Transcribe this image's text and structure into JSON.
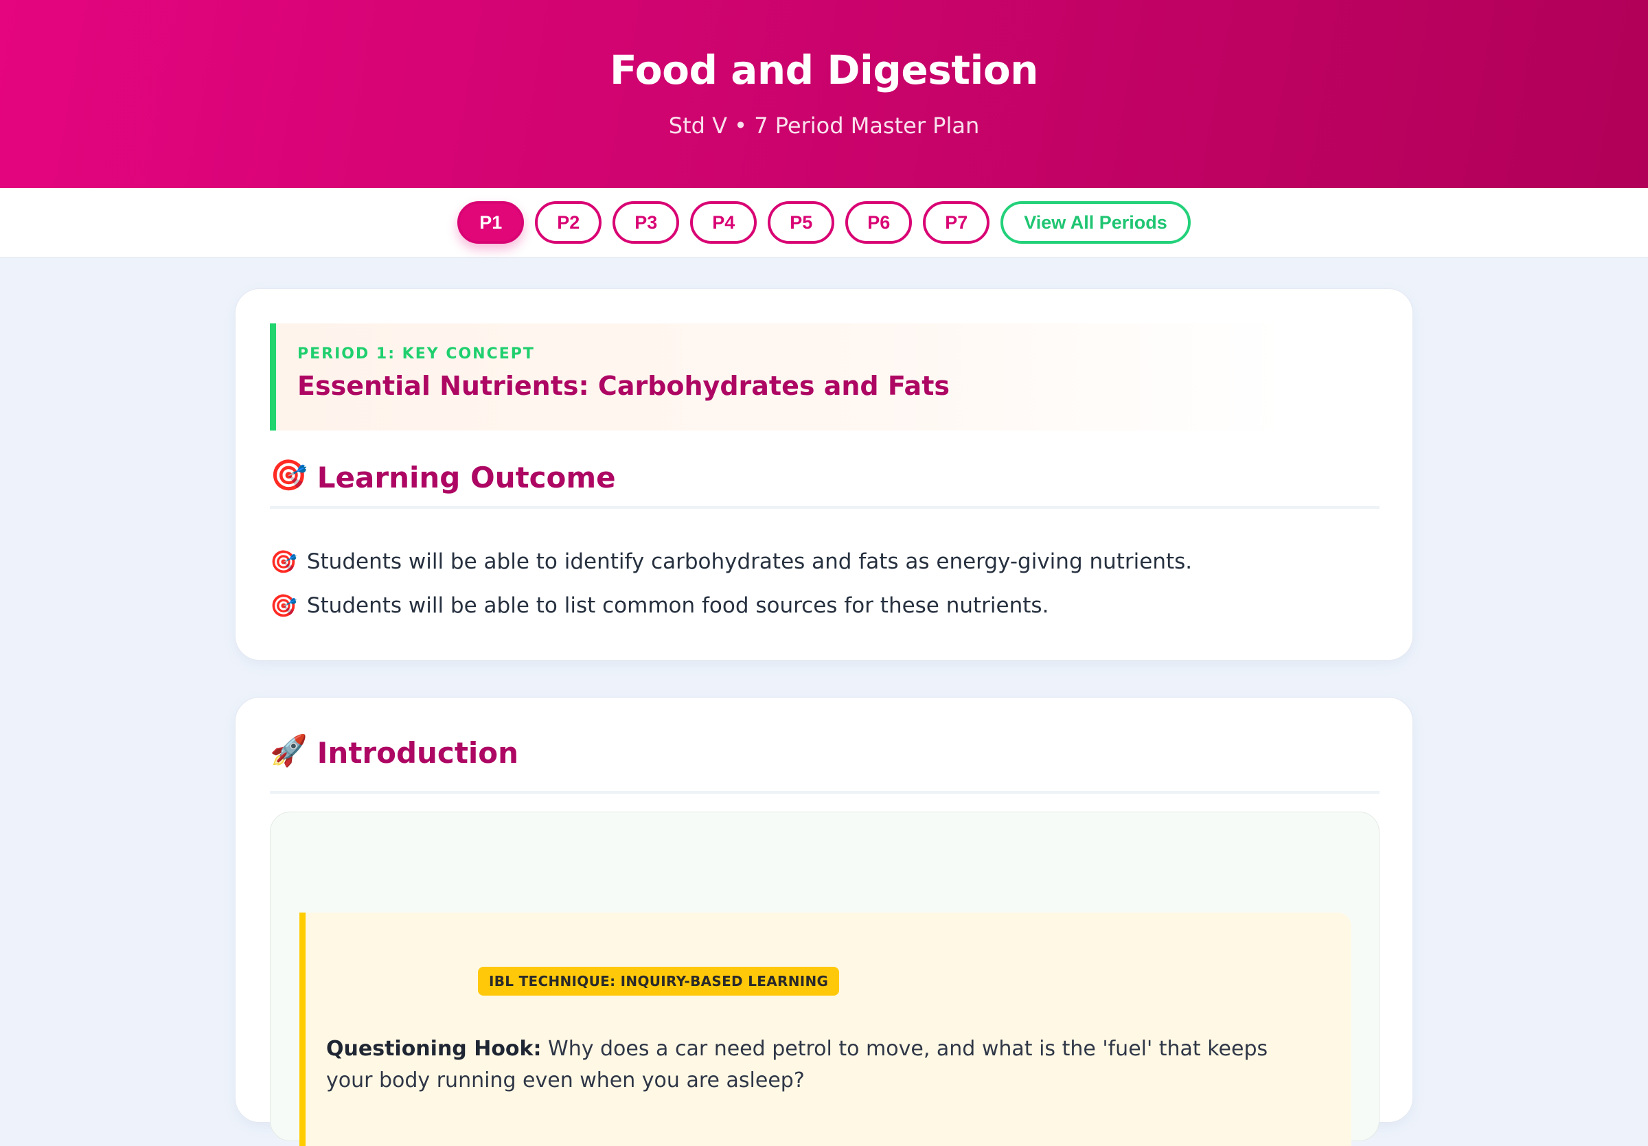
{
  "header": {
    "title": "Food and Digestion",
    "subtitle": "Std V • 7 Period Master Plan"
  },
  "nav": {
    "periods": [
      "P1",
      "P2",
      "P3",
      "P4",
      "P5",
      "P6",
      "P7"
    ],
    "active": "P1",
    "view_all_label": "View All Periods"
  },
  "key_concept": {
    "label": "PERIOD 1: KEY CONCEPT",
    "title": "Essential Nutrients: Carbohydrates and Fats"
  },
  "learning_outcome": {
    "icon": "target-icon",
    "heading": "Learning Outcome",
    "items": [
      "Students will be able to identify carbohydrates and fats as energy-giving nutrients.",
      "Students will be able to list common food sources for these nutrients."
    ]
  },
  "introduction": {
    "icon": "rocket-icon",
    "heading": "Introduction",
    "technique_badge": "IBL TECHNIQUE: INQUIRY-BASED LEARNING",
    "hook_label": "Questioning Hook:",
    "hook_text": "Why does a car need petrol to move, and what is the 'fuel' that keeps your body running even when you are asleep?"
  },
  "colors": {
    "brand": "#e20778",
    "brand_dark": "#ad0763",
    "accent_green": "#22d46e",
    "accent_yellow": "#ffcc00",
    "background": "#eef3fb"
  }
}
